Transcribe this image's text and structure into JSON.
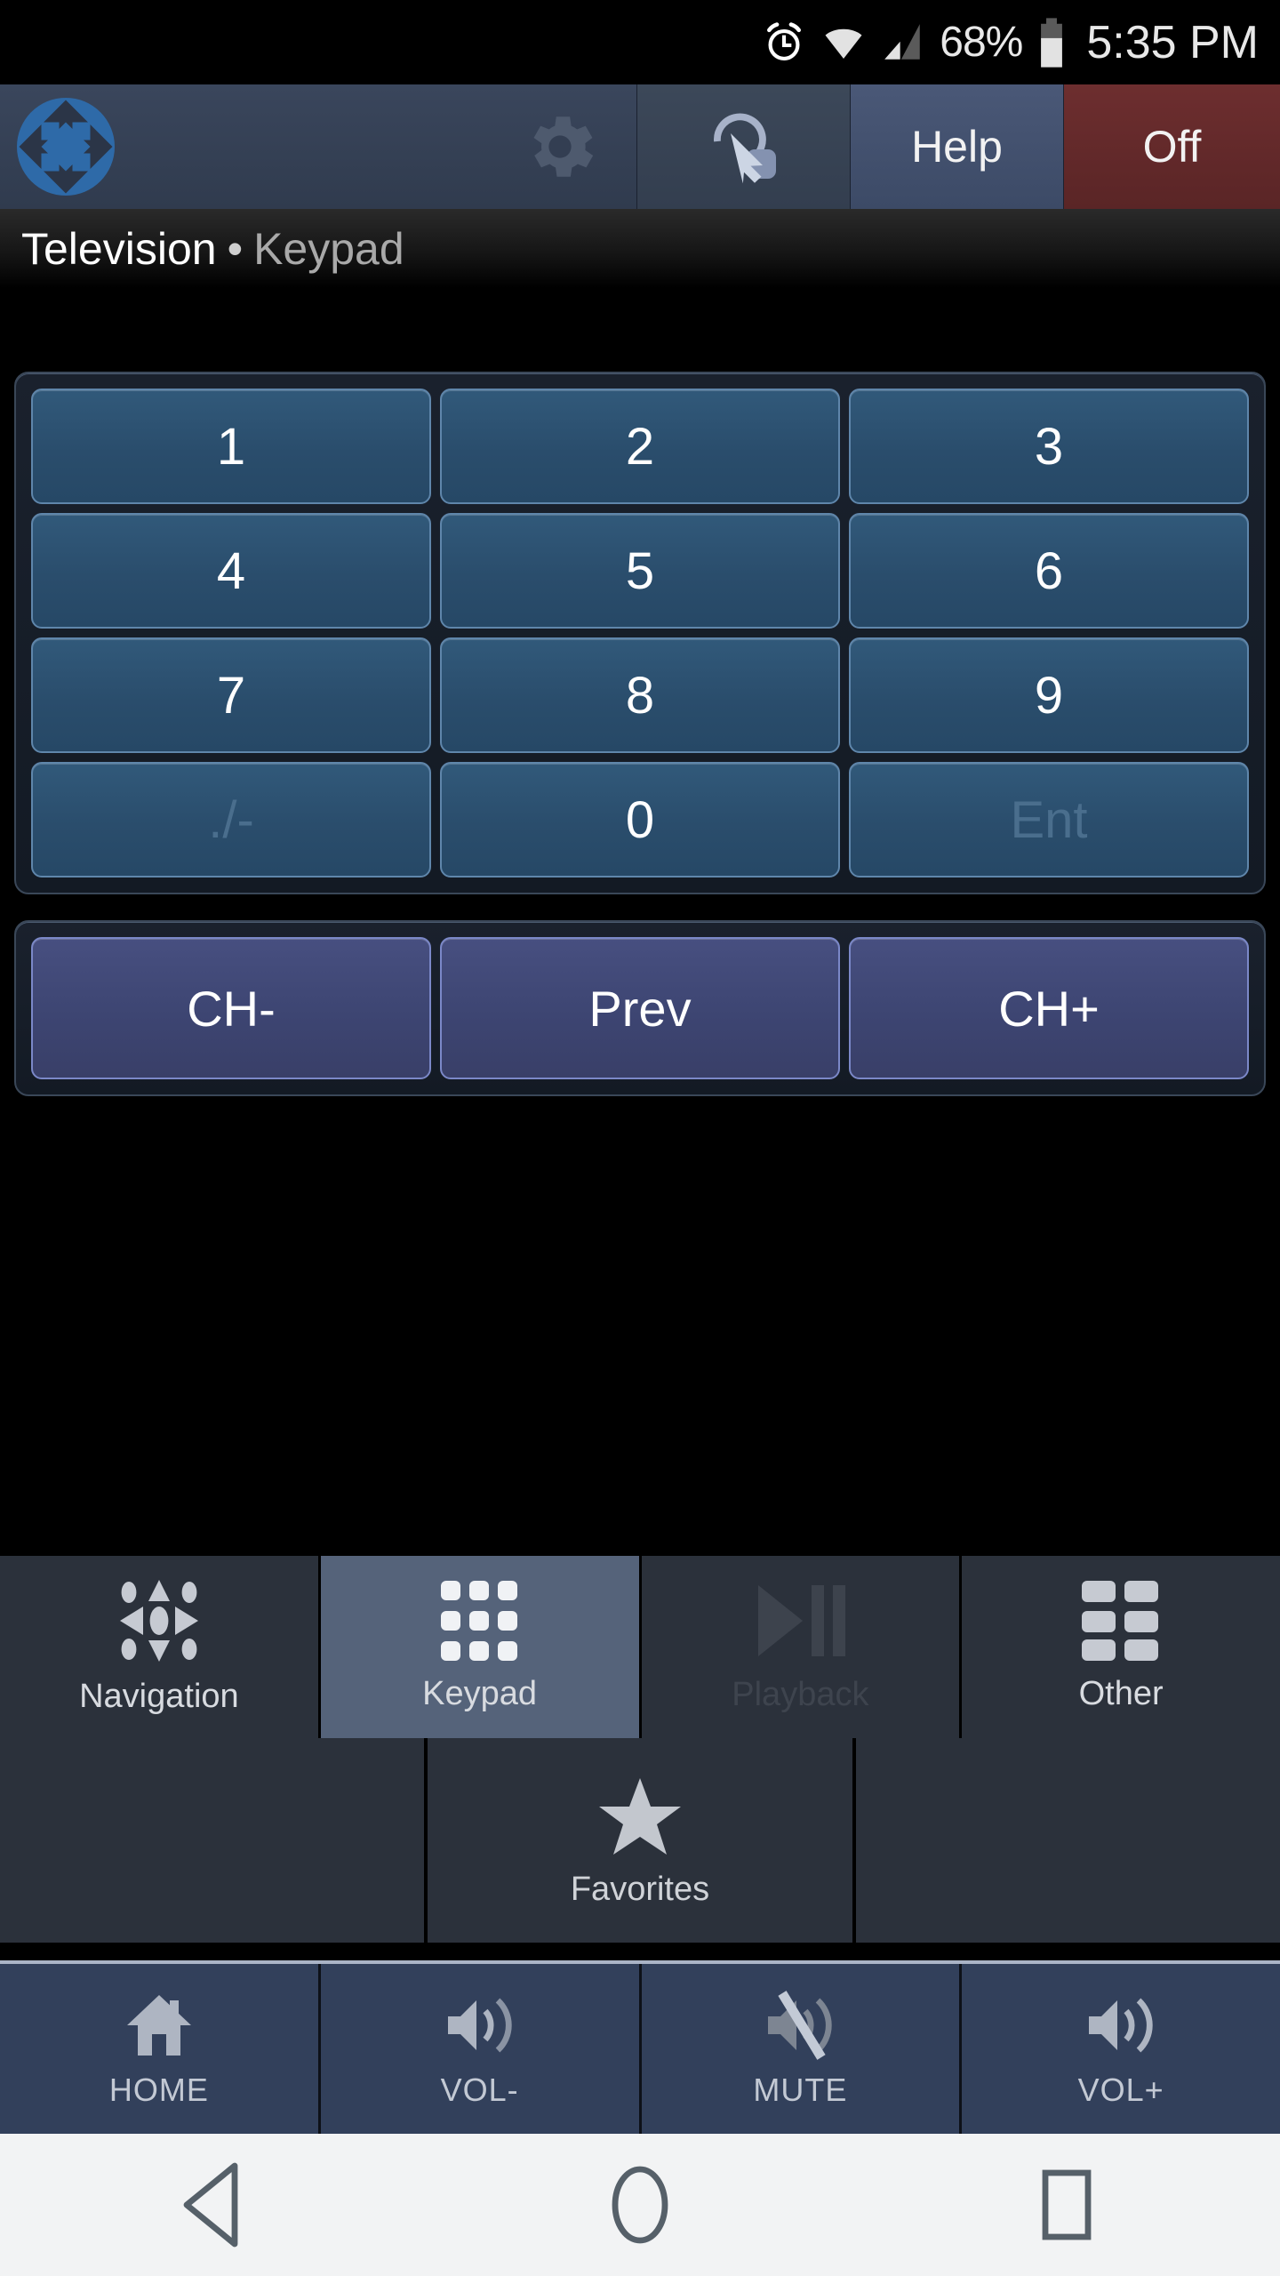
{
  "statusbar": {
    "alarm_icon": "alarm-icon",
    "wifi_icon": "wifi-icon",
    "signal_icon": "cell-signal-icon",
    "battery_percent": "68%",
    "battery_icon": "battery-icon",
    "time": "5:35 PM"
  },
  "toolbar": {
    "logo_icon": "app-logo-icon",
    "settings_icon": "gear-icon",
    "gesture_icon": "drag-gesture-icon",
    "help_label": "Help",
    "off_label": "Off",
    "off_color": "#6d2e2f",
    "help_color": "#4a5877"
  },
  "breadcrumb": {
    "device": "Television",
    "separator": "•",
    "page": "Keypad"
  },
  "keypad": {
    "keys": [
      {
        "label": "1",
        "disabled": false
      },
      {
        "label": "2",
        "disabled": false
      },
      {
        "label": "3",
        "disabled": false
      },
      {
        "label": "4",
        "disabled": false
      },
      {
        "label": "5",
        "disabled": false
      },
      {
        "label": "6",
        "disabled": false
      },
      {
        "label": "7",
        "disabled": false
      },
      {
        "label": "8",
        "disabled": false
      },
      {
        "label": "9",
        "disabled": false
      },
      {
        "label": "./-",
        "disabled": true
      },
      {
        "label": "0",
        "disabled": false
      },
      {
        "label": "Ent",
        "disabled": true
      }
    ],
    "key_color": "#2a4d6c",
    "key_border": "#5f86ab"
  },
  "channel_row": {
    "keys": [
      {
        "label": "CH-"
      },
      {
        "label": "Prev"
      },
      {
        "label": "CH+"
      }
    ],
    "key_color": "#3d4572",
    "key_border": "#7b88c8"
  },
  "tabs": [
    {
      "label": "Navigation",
      "icon": "dpad-icon",
      "active": false,
      "disabled": false
    },
    {
      "label": "Keypad",
      "icon": "keypad-grid-icon",
      "active": true,
      "disabled": false
    },
    {
      "label": "Playback",
      "icon": "play-pause-icon",
      "active": false,
      "disabled": true
    },
    {
      "label": "Other",
      "icon": "other-grid-icon",
      "active": false,
      "disabled": false
    }
  ],
  "favorites_row": [
    {
      "label": "",
      "icon": ""
    },
    {
      "label": "Favorites",
      "icon": "star-icon"
    },
    {
      "label": "",
      "icon": ""
    }
  ],
  "action_bar": [
    {
      "label": "HOME",
      "icon": "home-icon"
    },
    {
      "label": "VOL-",
      "icon": "volume-down-icon"
    },
    {
      "label": "MUTE",
      "icon": "volume-mute-icon"
    },
    {
      "label": "VOL+",
      "icon": "volume-up-icon"
    }
  ],
  "android_nav": [
    {
      "name": "back",
      "icon": "back-triangle-icon"
    },
    {
      "name": "home",
      "icon": "home-circle-icon"
    },
    {
      "name": "recents",
      "icon": "recents-square-icon"
    }
  ]
}
